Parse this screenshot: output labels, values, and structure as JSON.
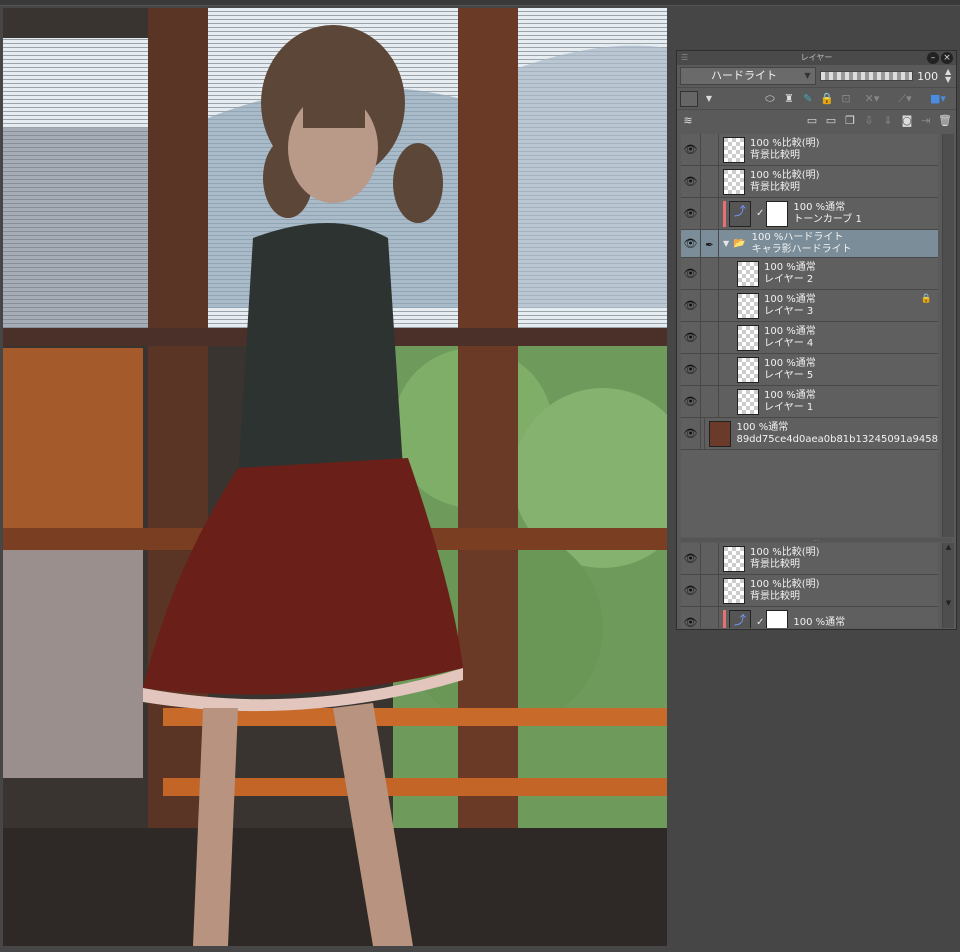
{
  "panel": {
    "title": "レイヤー",
    "blend_mode": "ハードライト",
    "opacity": "100"
  },
  "layers_main": [
    {
      "line1": "100 %比較(明)",
      "line2": "背景比較明",
      "indent": 0,
      "kind": "layer"
    },
    {
      "line1": "100 %比較(明)",
      "line2": "背景比較明",
      "indent": 0,
      "kind": "layer"
    },
    {
      "line1": "100 %通常",
      "line2": "トーンカーブ 1",
      "indent": 0,
      "kind": "correction"
    },
    {
      "line1": "100 %ハードライト",
      "line2": "キャラ影ハードライト",
      "indent": 0,
      "kind": "folder"
    },
    {
      "line1": "100 %通常",
      "line2": "レイヤー 2",
      "indent": 1,
      "kind": "layer"
    },
    {
      "line1": "100 %通常",
      "line2": "レイヤー 3",
      "indent": 1,
      "kind": "layer",
      "locked": true
    },
    {
      "line1": "100 %通常",
      "line2": "レイヤー 4",
      "indent": 1,
      "kind": "layer"
    },
    {
      "line1": "100 %通常",
      "line2": "レイヤー 5",
      "indent": 1,
      "kind": "layer"
    },
    {
      "line1": "100 %通常",
      "line2": "レイヤー 1",
      "indent": 1,
      "kind": "layer"
    },
    {
      "line1": "100 %通常",
      "line2": "89dd75ce4d0aea0b81b13245091a9458",
      "indent": 0,
      "kind": "image"
    }
  ],
  "layers_lower": [
    {
      "line1": "100 %比較(明)",
      "line2": "背景比較明",
      "kind": "layer"
    },
    {
      "line1": "100 %比較(明)",
      "line2": "背景比較明",
      "kind": "layer"
    },
    {
      "line1": "100 %通常",
      "line2": "",
      "kind": "correction"
    }
  ]
}
